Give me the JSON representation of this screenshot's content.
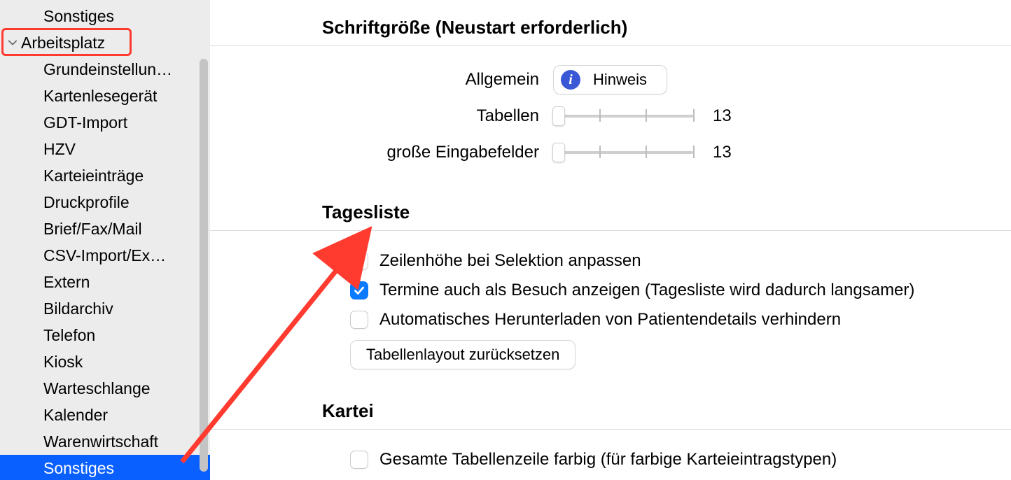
{
  "sidebar": {
    "top_item": "Sonstiges",
    "group": "Arbeitsplatz",
    "items": [
      "Grundeinstellun…",
      "Kartenlesegerät",
      "GDT-Import",
      "HZV",
      "Karteieinträge",
      "Druckprofile",
      "Brief/Fax/Mail",
      "CSV-Import/Ex…",
      "Extern",
      "Bildarchiv",
      "Telefon",
      "Kiosk",
      "Warteschlange",
      "Kalender",
      "Warenwirtschaft",
      "Sonstiges"
    ],
    "selected_index": 15
  },
  "main": {
    "font_section": {
      "title": "Schriftgröße (Neustart erforderlich)",
      "row_allgemein_label": "Allgemein",
      "hinweis_button": "Hinweis",
      "row_tabellen_label": "Tabellen",
      "tabellen_value": "13",
      "row_inputs_label": "große Eingabefelder",
      "inputs_value": "13"
    },
    "tagesliste": {
      "title": "Tagesliste",
      "chk1_label": "Zeilenhöhe bei Selektion anpassen",
      "chk1_checked": false,
      "chk2_label": "Termine auch als Besuch anzeigen (Tagesliste wird dadurch langsamer)",
      "chk2_checked": true,
      "chk3_label": "Automatisches Herunterladen von Patientendetails verhindern",
      "chk3_checked": false,
      "reset_button": "Tabellenlayout zurücksetzen"
    },
    "kartei": {
      "title": "Kartei",
      "chk1_label": "Gesamte Tabellenzeile farbig (für farbige Karteieintragstypen)",
      "chk1_checked": false
    }
  },
  "annotation": {
    "highlight": "Arbeitsplatz",
    "arrow_color": "#ff3b30"
  }
}
